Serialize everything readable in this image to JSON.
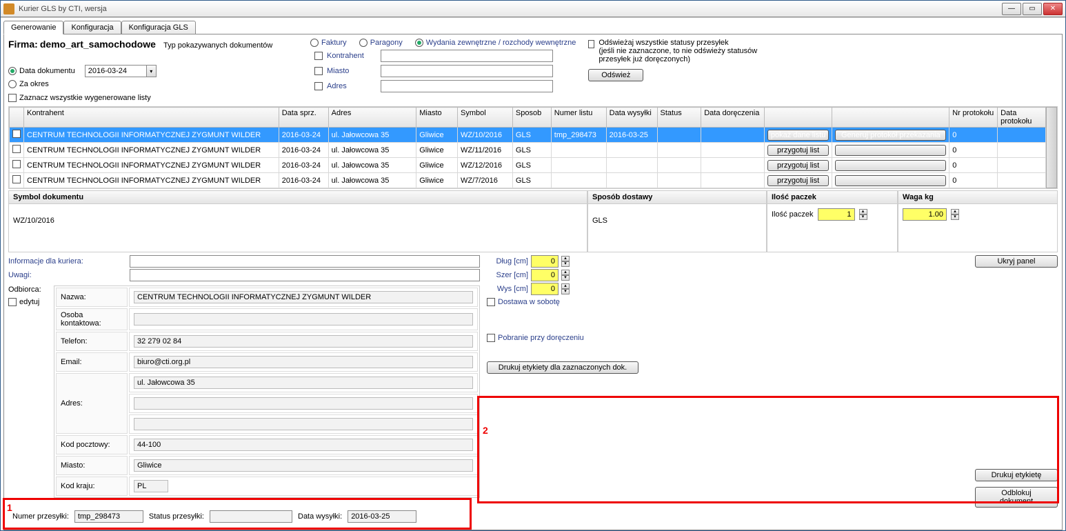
{
  "window": {
    "title": "Kurier GLS by CTI, wersja"
  },
  "tabs": [
    "Generowanie",
    "Konfiguracja",
    "Konfiguracja GLS"
  ],
  "firm": {
    "label": "Firma:",
    "value": "demo_art_samochodowe"
  },
  "doc_type_label": "Typ pokazywanych dokumentów",
  "doc_types": {
    "faktury": "Faktury",
    "paragony": "Paragony",
    "wydania": "Wydania zewnętrzne / rozchody wewnętrzne"
  },
  "date": {
    "radio_data": "Data dokumentu",
    "radio_za": "Za okres",
    "value": "2016-03-24"
  },
  "zazn_all": "Zaznacz wszystkie wygenerowane listy",
  "filters": {
    "kontrahent": "Kontrahent",
    "miasto": "Miasto",
    "adres": "Adres"
  },
  "refresh": {
    "text1": "Odświeżaj wszystkie statusy przesyłek",
    "text2": "(jeśli nie zaznaczone, to nie odświeży statusów przesyłek już doręczonych)",
    "button": "Odśwież"
  },
  "grid": {
    "headers": [
      "",
      "Kontrahent",
      "Data sprz.",
      "Adres",
      "Miasto",
      "Symbol",
      "Sposob",
      "Numer listu",
      "Data wysyłki",
      "Status",
      "Data doręczenia",
      "",
      "",
      "Nr protokołu",
      "Data protokołu"
    ],
    "btn_pokaz": "pokaż dane listu",
    "btn_generuj": "Generuj protokół przekazania",
    "btn_przygotuj": "przygotuj list",
    "rows": [
      {
        "kontrahent": "CENTRUM TECHNOLOGII INFORMATYCZNEJ ZYGMUNT WILDER",
        "data": "2016-03-24",
        "adres": "ul. Jałowcowa 35",
        "miasto": "Gliwice",
        "symbol": "WZ/10/2016",
        "sposob": "GLS",
        "numer": "tmp_298473",
        "wysylka": "2016-03-25",
        "status": "",
        "dorecz": "",
        "nrprot": "0",
        "dataprot": ""
      },
      {
        "kontrahent": "CENTRUM TECHNOLOGII INFORMATYCZNEJ ZYGMUNT WILDER",
        "data": "2016-03-24",
        "adres": "ul. Jałowcowa 35",
        "miasto": "Gliwice",
        "symbol": "WZ/11/2016",
        "sposob": "GLS",
        "numer": "",
        "wysylka": "",
        "status": "",
        "dorecz": "",
        "nrprot": "0",
        "dataprot": ""
      },
      {
        "kontrahent": "CENTRUM TECHNOLOGII INFORMATYCZNEJ ZYGMUNT WILDER",
        "data": "2016-03-24",
        "adres": "ul. Jałowcowa 35",
        "miasto": "Gliwice",
        "symbol": "WZ/12/2016",
        "sposob": "GLS",
        "numer": "",
        "wysylka": "",
        "status": "",
        "dorecz": "",
        "nrprot": "0",
        "dataprot": ""
      },
      {
        "kontrahent": "CENTRUM TECHNOLOGII INFORMATYCZNEJ ZYGMUNT WILDER",
        "data": "2016-03-24",
        "adres": "ul. Jałowcowa 35",
        "miasto": "Gliwice",
        "symbol": "WZ/7/2016",
        "sposob": "GLS",
        "numer": "",
        "wysylka": "",
        "status": "",
        "dorecz": "",
        "nrprot": "0",
        "dataprot": ""
      }
    ]
  },
  "panels": {
    "symbol": {
      "title": "Symbol dokumentu",
      "value": "WZ/10/2016"
    },
    "sposob": {
      "title": "Sposób dostawy",
      "value": "GLS"
    },
    "ilosc": {
      "title": "Ilość paczek",
      "label": "Ilość paczek",
      "value": "1"
    },
    "waga": {
      "title": "Waga kg",
      "value": "1.00"
    }
  },
  "info": {
    "kurier_label": "Informacje dla kuriera:",
    "uwagi_label": "Uwagi:"
  },
  "dims": {
    "dlug": "Dług [cm]",
    "szer": "Szer [cm]",
    "wys": "Wys [cm]",
    "v": "0"
  },
  "odbiorca": {
    "label": "Odbiorca:",
    "edytuj": "edytuj",
    "fields": {
      "nazwa": {
        "l": "Nazwa:",
        "v": "CENTRUM TECHNOLOGII INFORMATYCZNEJ ZYGMUNT WILDER"
      },
      "osoba": {
        "l": "Osoba kontaktowa:",
        "v": ""
      },
      "telefon": {
        "l": "Telefon:",
        "v": "32 279 02 84"
      },
      "email": {
        "l": "Email:",
        "v": "biuro@cti.org.pl"
      },
      "adres": {
        "l": "Adres:",
        "v": "ul. Jałowcowa 35"
      },
      "kod": {
        "l": "Kod pocztowy:",
        "v": "44-100"
      },
      "miasto": {
        "l": "Miasto:",
        "v": "Gliwice"
      },
      "kraj": {
        "l": "Kod kraju:",
        "v": "PL"
      }
    }
  },
  "checks": {
    "sobota": "Dostawa w sobotę",
    "pobranie": "Pobranie przy doręczeniu"
  },
  "buttons": {
    "ukryj": "Ukryj panel",
    "druk_zazn": "Drukuj etykiety dla zaznaczonych dok.",
    "druk_ety": "Drukuj etykietę",
    "odblokuj": "Odblokuj dokument"
  },
  "footer": {
    "numer_l": "Numer przesyłki:",
    "numer_v": "tmp_298473",
    "status_l": "Status przesyłki:",
    "status_v": "",
    "data_l": "Data wysyłki:",
    "data_v": "2016-03-25"
  },
  "annot": {
    "n1": "1",
    "n2": "2"
  }
}
